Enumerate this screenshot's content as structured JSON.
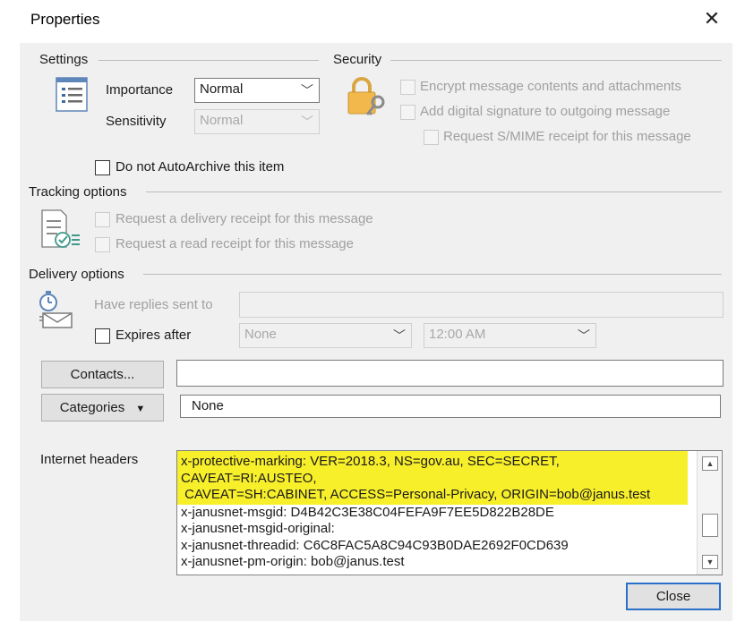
{
  "window": {
    "title": "Properties",
    "close_glyph": "✕"
  },
  "settings": {
    "section_label": "Settings",
    "importance_label": "Importance",
    "importance_value": "Normal",
    "sensitivity_label": "Sensitivity",
    "sensitivity_value": "Normal",
    "autoarchive_label": "Do not AutoArchive this item"
  },
  "security": {
    "section_label": "Security",
    "encrypt_label": "Encrypt message contents and attachments",
    "signature_label": "Add digital signature to outgoing message",
    "smime_label": "Request S/MIME receipt for this message"
  },
  "tracking": {
    "section_label": "Tracking options",
    "delivery_receipt_label": "Request a delivery receipt for this message",
    "read_receipt_label": "Request a read receipt for this message"
  },
  "delivery": {
    "section_label": "Delivery options",
    "replies_label": "Have replies sent to",
    "replies_value": "",
    "expires_label": "Expires after",
    "expires_date": "None",
    "expires_time": "12:00 AM"
  },
  "contacts": {
    "button_label": "Contacts...",
    "value": ""
  },
  "categories": {
    "button_label": "Categories",
    "value": "None"
  },
  "headers": {
    "label": "Internet headers",
    "highlighted_lines": [
      "x-protective-marking: VER=2018.3, NS=gov.au, SEC=SECRET,",
      "CAVEAT=RI:AUSTEO,",
      " CAVEAT=SH:CABINET, ACCESS=Personal-Privacy, ORIGIN=bob@janus.test"
    ],
    "lines": [
      "x-janusnet-msgid: D4B42C3E38C04FEFA9F7EE5D822B28DE",
      "x-janusnet-msgid-original:",
      "x-janusnet-threadid: C6C8FAC5A8C94C93B0DAE2692F0CD639",
      "x-janusnet-pm-origin: bob@janus.test"
    ]
  },
  "footer": {
    "close_label": "Close"
  },
  "colors": {
    "highlight": "#f8ef2b",
    "primary_border": "#2a6fc9",
    "panel_bg": "#f0f0f0"
  }
}
